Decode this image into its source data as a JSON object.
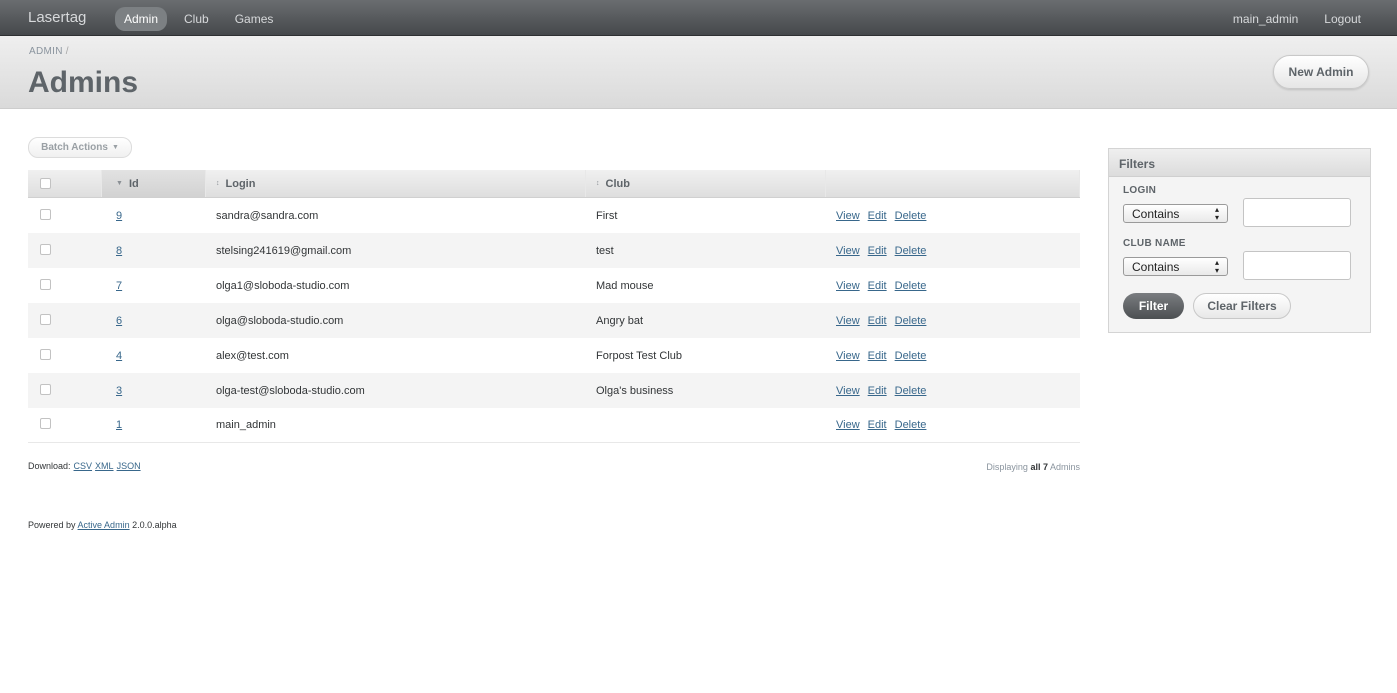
{
  "header": {
    "brand": "Lasertag",
    "nav": [
      {
        "label": "Admin",
        "active": true
      },
      {
        "label": "Club",
        "active": false
      },
      {
        "label": "Games",
        "active": false
      }
    ],
    "user": "main_admin",
    "logout": "Logout"
  },
  "titlebar": {
    "breadcrumb": "ADMIN",
    "breadcrumb_sep": "/",
    "title": "Admins",
    "new_button": "New Admin"
  },
  "batch_actions": "Batch Actions",
  "table": {
    "columns": [
      "Id",
      "Login",
      "Club"
    ],
    "rows": [
      {
        "id": "9",
        "login": "sandra@sandra.com",
        "club": "First",
        "actions": [
          "View",
          "Edit",
          "Delete"
        ]
      },
      {
        "id": "8",
        "login": "stelsing241619@gmail.com",
        "club": "test",
        "actions": [
          "View",
          "Edit",
          "Delete"
        ]
      },
      {
        "id": "7",
        "login": "olga1@sloboda-studio.com",
        "club": "Mad mouse",
        "actions": [
          "View",
          "Edit",
          "Delete"
        ]
      },
      {
        "id": "6",
        "login": "olga@sloboda-studio.com",
        "club": "Angry bat",
        "actions": [
          "View",
          "Edit",
          "Delete"
        ]
      },
      {
        "id": "4",
        "login": "alex@test.com",
        "club": "Forpost Test Club",
        "actions": [
          "View",
          "Edit",
          "Delete"
        ]
      },
      {
        "id": "3",
        "login": "olga-test@sloboda-studio.com",
        "club": "Olga's business",
        "actions": [
          "View",
          "Edit",
          "Delete"
        ]
      },
      {
        "id": "1",
        "login": "main_admin",
        "club": "",
        "actions": [
          "View",
          "Edit",
          "Delete"
        ]
      }
    ]
  },
  "footer": {
    "download_label": "Download:",
    "formats": [
      "CSV",
      "XML",
      "JSON"
    ],
    "displaying_prefix": "Displaying",
    "displaying_bold": "all 7",
    "displaying_suffix": "Admins",
    "powered_prefix": "Powered by",
    "powered_link": "Active Admin",
    "powered_version": "2.0.0.alpha"
  },
  "filters": {
    "title": "Filters",
    "fields": [
      {
        "label": "LOGIN",
        "operator": "Contains",
        "value": ""
      },
      {
        "label": "CLUB NAME",
        "operator": "Contains",
        "value": ""
      }
    ],
    "filter_button": "Filter",
    "clear_button": "Clear Filters"
  },
  "colors": {
    "header_bg": "#55585b",
    "link": "#38678b",
    "title_text": "#5e6469"
  }
}
